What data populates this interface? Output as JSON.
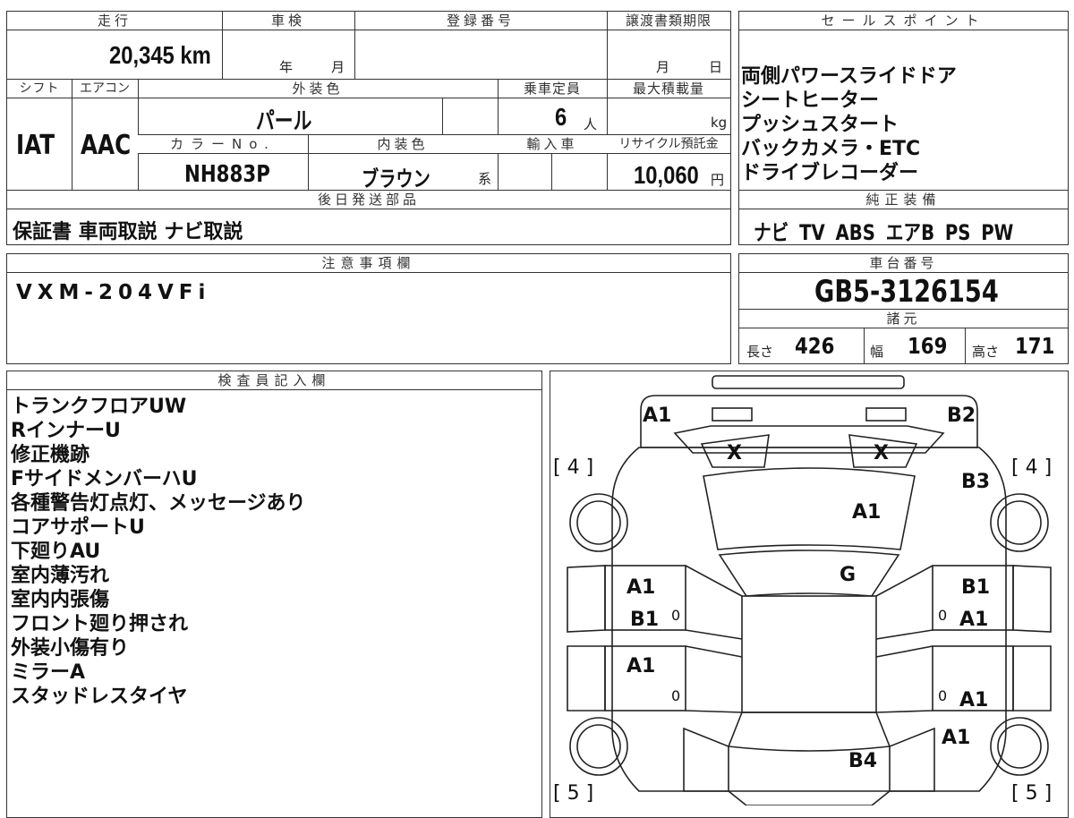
{
  "top": {
    "mileage_header": "走行",
    "mileage": "20,345 km",
    "inspection_header": "車検",
    "inspection_year_unit": "年",
    "inspection_month_unit": "月",
    "registration_header": "登録番号",
    "transfer_header": "譲渡書類期限",
    "transfer_month_unit": "月",
    "transfer_day_unit": "日"
  },
  "row2": {
    "shift_header": "シフト",
    "ac_header": "エアコン",
    "exterior_color_header": "外装色",
    "capacity_header": "乗車定員",
    "max_load_header": "最大積載量",
    "shift": "IAT",
    "ac": "AAC",
    "exterior_color": "パール",
    "capacity": "6",
    "capacity_unit": "人",
    "max_load_unit": "kg",
    "color_no_header": "カラーNo.",
    "interior_color_header": "内装色",
    "import_header": "輸入車",
    "recycle_header": "リサイクル預託金",
    "color_no": "NH883P",
    "interior_color": "ブラウン",
    "interior_color_suffix": "系",
    "recycle_fee": "10,060",
    "recycle_unit": "円"
  },
  "later_parts": {
    "header": "後日発送部品",
    "value": "保証書 車両取説 ナビ取説"
  },
  "sales_points": {
    "header": "セールスポイント",
    "items": [
      "両側パワースライドドア",
      "シートヒーター",
      "プッシュスタート",
      "バックカメラ・ETC",
      "ドライブレコーダー"
    ]
  },
  "genuine_equipment": {
    "header": "純正装備",
    "value": "ナビ TV ABS エアB PS PW"
  },
  "notes": {
    "header": "注意事項欄",
    "value": "VXM-204VFi"
  },
  "chassis": {
    "header": "車台番号",
    "value": "GB5-3126154"
  },
  "specs": {
    "header": "諸元",
    "length_label": "長さ",
    "length": "426",
    "width_label": "幅",
    "width": "169",
    "height_label": "高さ",
    "height": "171"
  },
  "inspector": {
    "header": "検査員記入欄",
    "items": [
      "トランクフロアUW",
      "RインナーU",
      "修正機跡",
      "FサイドメンバーハU",
      "各種警告灯点灯、メッセージあり",
      "コアサポートU",
      "下廻りAU",
      "室内薄汚れ",
      "室内内張傷",
      "フロント廻り押され",
      "外装小傷有り",
      "ミラーA",
      "スタッドレスタイヤ"
    ]
  },
  "diagram": {
    "labels": {
      "a1_top_left": "A1",
      "b2_top_right": "B2",
      "x_left": "X",
      "x_right": "X",
      "tire_left_top": "[ 4 ]",
      "tire_right_top": "[ 4 ]",
      "b3": "B3",
      "a1_hood": "A1",
      "g_windshield": "G",
      "a1_left_front_door": "A1",
      "b1_left_front_door": "B1",
      "b1_right_front_door": "B1",
      "a1_right_front_door": "A1",
      "a1_left_rear_door": "A1",
      "a1_right_rear_door": "A1",
      "a1_right_rear": "A1",
      "b4": "B4",
      "tire_left_bottom": "[ 5 ]",
      "tire_right_bottom": "[ 5 ]",
      "zero_lf": "0",
      "zero_lr": "0",
      "zero_rf": "0",
      "zero_rr": "0"
    }
  }
}
